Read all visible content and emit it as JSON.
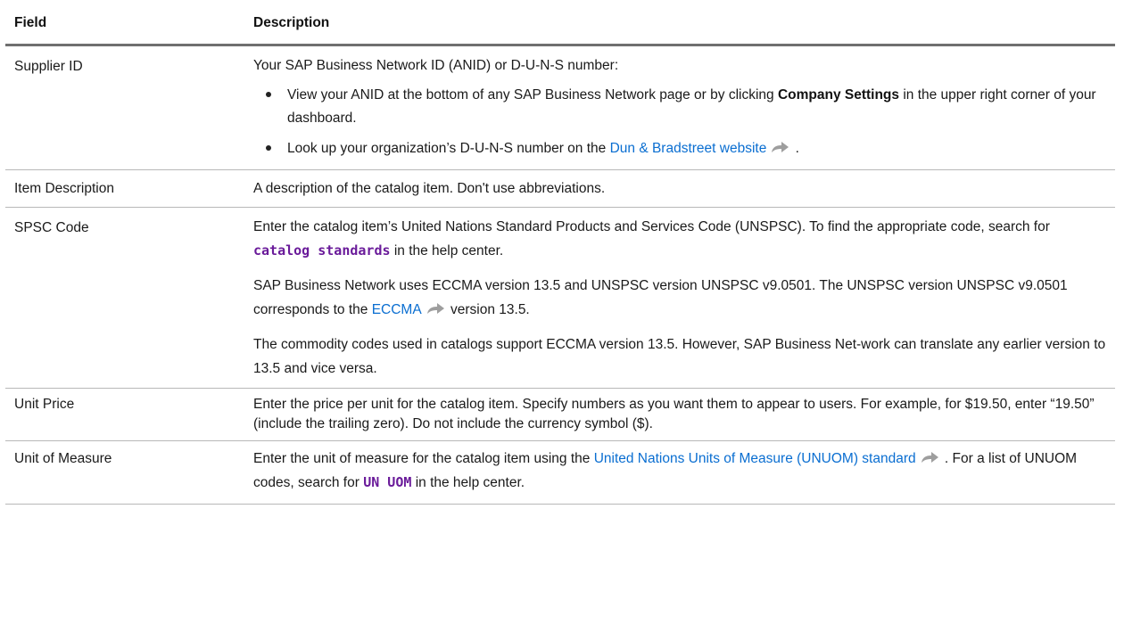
{
  "headers": {
    "field": "Field",
    "description": "Description"
  },
  "rows": {
    "supplier_id": {
      "field": "Supplier ID",
      "intro": "Your SAP Business Network ID (ANID) or D-U-N-S number:",
      "bullet1_a": "View your ANID at the bottom of any SAP Business Network page or by clicking ",
      "bullet1_bold": "Company Settings",
      "bullet1_b": " in the upper right corner of your dashboard.",
      "bullet2_a": "Look up your organization’s D-U-N-S number on the ",
      "bullet2_link": "Dun & Bradstreet website",
      "bullet2_b": " ."
    },
    "item_description": {
      "field": "Item Description",
      "text": "A description of the catalog item. Don't use abbreviations."
    },
    "spsc_code": {
      "field": "SPSC Code",
      "p1_a": "Enter the catalog item’s United Nations Standard Products and Services Code (UNSPSC). To find the appropriate code, search for ",
      "p1_code": "catalog standards",
      "p1_b": " in the help center.",
      "p2_a": "SAP Business Network uses ECCMA version 13.5 and UNSPSC version UNSPSC v9.0501. The UNSPSC version UNSPSC v9.0501 corresponds to the ",
      "p2_link": "ECCMA",
      "p2_b": " version 13.5.",
      "p3": "The commodity codes used in catalogs support ECCMA version 13.5. However, SAP Business Net-work can translate any earlier version to 13.5 and vice versa."
    },
    "unit_price": {
      "field": "Unit Price",
      "text": "Enter the price per unit for the catalog item. Specify numbers as you want them to appear to users. For example, for $19.50, enter “19.50” (include the trailing zero). Do not include the currency symbol ($)."
    },
    "unit_of_measure": {
      "field": "Unit of Measure",
      "p_a": "Enter the unit of measure for the catalog item using the ",
      "p_link": "United Nations Units of Measure (UNUOM) standard",
      "p_b": " . For a list of UNUOM codes, search for ",
      "p_code": "UN UOM",
      "p_c": " in the help center."
    }
  },
  "icons": {
    "external_link": "external-link-arrow-icon"
  },
  "colors": {
    "link": "#0a6ed1",
    "code": "#6a1b9a",
    "header_rule": "#6f6f6f",
    "row_rule": "#b8b8b8"
  }
}
